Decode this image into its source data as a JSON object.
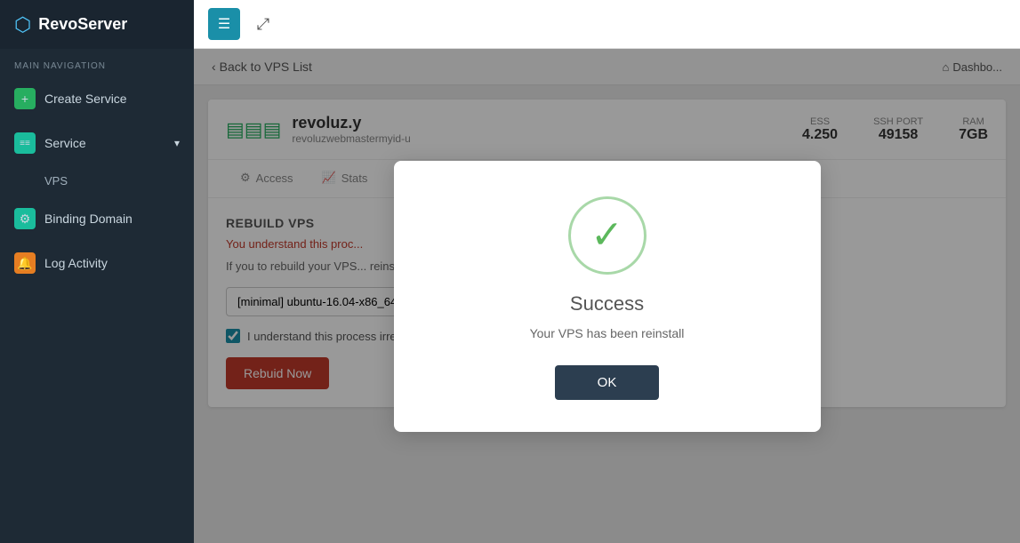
{
  "sidebar": {
    "logo": "RevoServer",
    "nav_label": "MAIN NAVIGATION",
    "items": [
      {
        "id": "create-service",
        "label": "Create Service",
        "icon": "+",
        "icon_color": "green"
      },
      {
        "id": "service",
        "label": "Service",
        "icon": "≡",
        "icon_color": "teal",
        "has_chevron": true
      },
      {
        "id": "vps",
        "label": "VPS",
        "sub": true
      },
      {
        "id": "binding-domain",
        "label": "Binding Domain",
        "icon": "⚙",
        "icon_color": "teal"
      },
      {
        "id": "log-activity",
        "label": "Log Activity",
        "icon": "🔔",
        "icon_color": "orange"
      }
    ]
  },
  "topbar": {
    "menu_icon": "☰",
    "expand_icon": "⤢"
  },
  "breadcrumb": {
    "back_label": "Back to VPS List",
    "right_label": "Dashbo..."
  },
  "vps": {
    "name": "revoluz.y",
    "username": "revoluzwebmastermyid-u",
    "stats": [
      {
        "label": "ESS",
        "value": "4.250"
      },
      {
        "label": "SSH PORT",
        "value": "49158"
      },
      {
        "label": "RAM",
        "value": "7GB"
      }
    ],
    "tabs": [
      {
        "label": "Access",
        "icon": "⚙"
      },
      {
        "label": "Stats",
        "icon": "📈"
      }
    ]
  },
  "rebuild": {
    "title": "REBUILD VPS",
    "warning": "You understand this proc...",
    "description": "If you to rebuild your VPS...                     reinstall it to your VPS.",
    "os_options": [
      "[minimal] ubuntu-16.04-x86_64"
    ],
    "os_selected": "[minimal] ubuntu-16.04-x86_64",
    "checkbox_label": "I understand this process irrecoverable",
    "button_label": "Rebuid Now"
  },
  "modal": {
    "title": "Success",
    "message": "Your VPS has been reinstall",
    "ok_label": "OK"
  }
}
